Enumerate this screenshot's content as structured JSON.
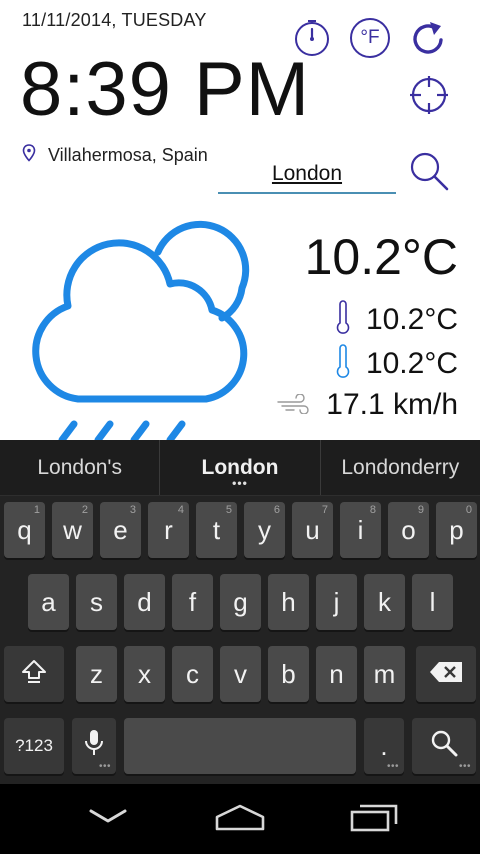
{
  "header": {
    "date": "11/11/2014, TUESDAY",
    "time": "8:39 PM",
    "location": "Villahermosa, Spain"
  },
  "search": {
    "value": "London"
  },
  "weather": {
    "condition_icon": "cloud-sun-rain-icon",
    "temperature": "10.2°C",
    "max_temperature": "10.2°C",
    "min_temperature": "10.2°C",
    "wind_speed": "17.1 km/h"
  },
  "icons": {
    "stopwatch": "stopwatch-icon",
    "fahrenheit": "°F",
    "refresh": "refresh-icon",
    "locate": "crosshair-icon",
    "search": "search-icon"
  },
  "colors": {
    "accent_icon": "#3a2fa0",
    "weather_icon": "#1e88e5",
    "search_underline": "#4a8fb3",
    "keyboard_bg": "#232323",
    "key_bg": "#4a4a4a"
  },
  "keyboard": {
    "suggestions": [
      "London's",
      "London",
      "Londonderry"
    ],
    "row1": [
      "q",
      "w",
      "e",
      "r",
      "t",
      "y",
      "u",
      "i",
      "o",
      "p"
    ],
    "row1_hints": [
      "1",
      "2",
      "3",
      "4",
      "5",
      "6",
      "7",
      "8",
      "9",
      "0"
    ],
    "row2": [
      "a",
      "s",
      "d",
      "f",
      "g",
      "h",
      "j",
      "k",
      "l"
    ],
    "row3": [
      "z",
      "x",
      "c",
      "v",
      "b",
      "n",
      "m"
    ],
    "symbols_label": "?123",
    "period_label": "."
  }
}
